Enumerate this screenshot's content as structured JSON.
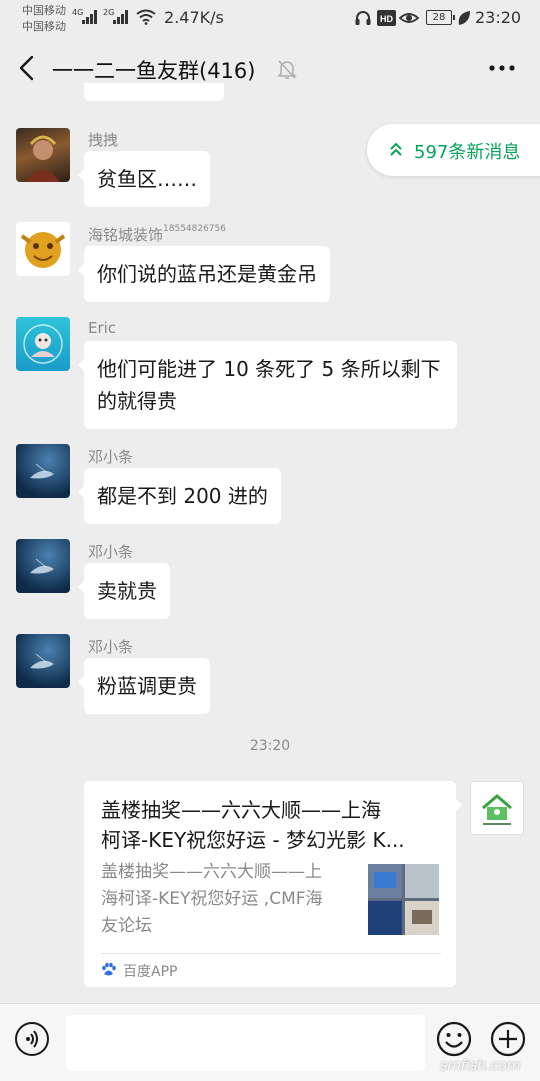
{
  "status_bar": {
    "carrier_1": "中国移动",
    "carrier_2": "中国移动",
    "signal_1": "4G",
    "signal_2": "2G",
    "net_speed": "2.47K/s",
    "battery": "28",
    "time": "23:20"
  },
  "header": {
    "title": "一一二一鱼友群(416)",
    "icons": [
      "back-icon",
      "mute-bell-icon",
      "more-icon"
    ]
  },
  "new_messages_pill": "597条新消息",
  "messages": [
    {
      "sender": "拽拽",
      "text": "贫鱼区……"
    },
    {
      "sender": "海铭城装饰",
      "sender_suffix": "18554826756",
      "text": "你们说的蓝吊还是黄金吊"
    },
    {
      "sender": "Eric",
      "text": "他们可能进了 10 条死了 5 条所以剩下的就得贵"
    },
    {
      "sender": "邓小条",
      "text": "都是不到 200 进的"
    },
    {
      "sender": "邓小条",
      "text": "卖就贵"
    },
    {
      "sender": "邓小条",
      "text": "粉蓝调更贵"
    }
  ],
  "time_divider": "23:20",
  "link_card": {
    "title": "盖楼抽奖——六六大顺——上海\n柯译-KEY祝您好运 - 梦幻光影 K...",
    "description": " 盖楼抽奖——六六大顺——上\n海柯译-KEY祝您好运 ,CMF海\n友论坛",
    "source": "百度APP"
  },
  "input_bar": {
    "message_value": "",
    "icons": [
      "voice-icon",
      "emoji-icon",
      "plus-icon"
    ]
  },
  "watermark": "smfish.com",
  "colors": {
    "background": "#ededed",
    "bubble": "#ffffff",
    "accent_green": "#07a35a",
    "meta_gray": "#8a8a8a"
  }
}
